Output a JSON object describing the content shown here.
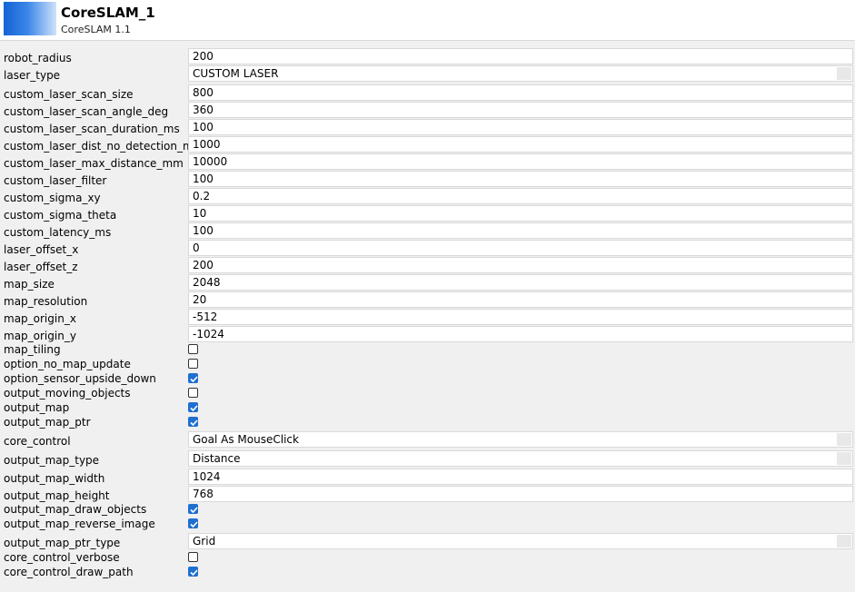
{
  "header": {
    "title": "CoreSLAM_1",
    "subtitle": "CoreSLAM 1.1"
  },
  "rows": [
    {
      "label": "robot_radius",
      "type": "text",
      "value": "200"
    },
    {
      "label": "laser_type",
      "type": "select",
      "value": "CUSTOM LASER"
    },
    {
      "label": "custom_laser_scan_size",
      "type": "text",
      "value": "800"
    },
    {
      "label": "custom_laser_scan_angle_deg",
      "type": "text",
      "value": "360"
    },
    {
      "label": "custom_laser_scan_duration_ms",
      "type": "text",
      "value": "100"
    },
    {
      "label": "custom_laser_dist_no_detection_mm",
      "type": "text",
      "value": "1000"
    },
    {
      "label": "custom_laser_max_distance_mm",
      "type": "text",
      "value": "10000"
    },
    {
      "label": "custom_laser_filter",
      "type": "text",
      "value": "100"
    },
    {
      "label": "custom_sigma_xy",
      "type": "text",
      "value": "0.2"
    },
    {
      "label": "custom_sigma_theta",
      "type": "text",
      "value": "10"
    },
    {
      "label": "custom_latency_ms",
      "type": "text",
      "value": "100"
    },
    {
      "label": "laser_offset_x",
      "type": "text",
      "value": "0"
    },
    {
      "label": "laser_offset_z",
      "type": "text",
      "value": "200"
    },
    {
      "label": "map_size",
      "type": "text",
      "value": "2048"
    },
    {
      "label": "map_resolution",
      "type": "text",
      "value": "20"
    },
    {
      "label": "map_origin_x",
      "type": "text",
      "value": "-512"
    },
    {
      "label": "map_origin_y",
      "type": "text",
      "value": "-1024"
    },
    {
      "label": "map_tiling",
      "type": "checkbox",
      "checked": false
    },
    {
      "label": "option_no_map_update",
      "type": "checkbox",
      "checked": false
    },
    {
      "label": "option_sensor_upside_down",
      "type": "checkbox",
      "checked": true
    },
    {
      "label": "output_moving_objects",
      "type": "checkbox",
      "checked": false
    },
    {
      "label": "output_map",
      "type": "checkbox",
      "checked": true
    },
    {
      "label": "output_map_ptr",
      "type": "checkbox",
      "checked": true
    },
    {
      "label": "core_control",
      "type": "select",
      "value": "Goal As MouseClick"
    },
    {
      "label": "output_map_type",
      "type": "select",
      "value": "Distance"
    },
    {
      "label": "output_map_width",
      "type": "text",
      "value": "1024"
    },
    {
      "label": "output_map_height",
      "type": "text",
      "value": "768"
    },
    {
      "label": "output_map_draw_objects",
      "type": "checkbox",
      "checked": true
    },
    {
      "label": "output_map_reverse_image",
      "type": "checkbox",
      "checked": true
    },
    {
      "label": "output_map_ptr_type",
      "type": "select",
      "value": "Grid"
    },
    {
      "label": "core_control_verbose",
      "type": "checkbox",
      "checked": false
    },
    {
      "label": "core_control_draw_path",
      "type": "checkbox",
      "checked": true
    }
  ],
  "colors": {
    "checkbox_checked": "#1f6fd1",
    "field_background": "#ffffff",
    "panel_background": "#f0f0f0"
  },
  "icons": {
    "logo": "coreslam-logo",
    "dropdown": "dropdown-indicator",
    "check": "checkmark-icon"
  }
}
